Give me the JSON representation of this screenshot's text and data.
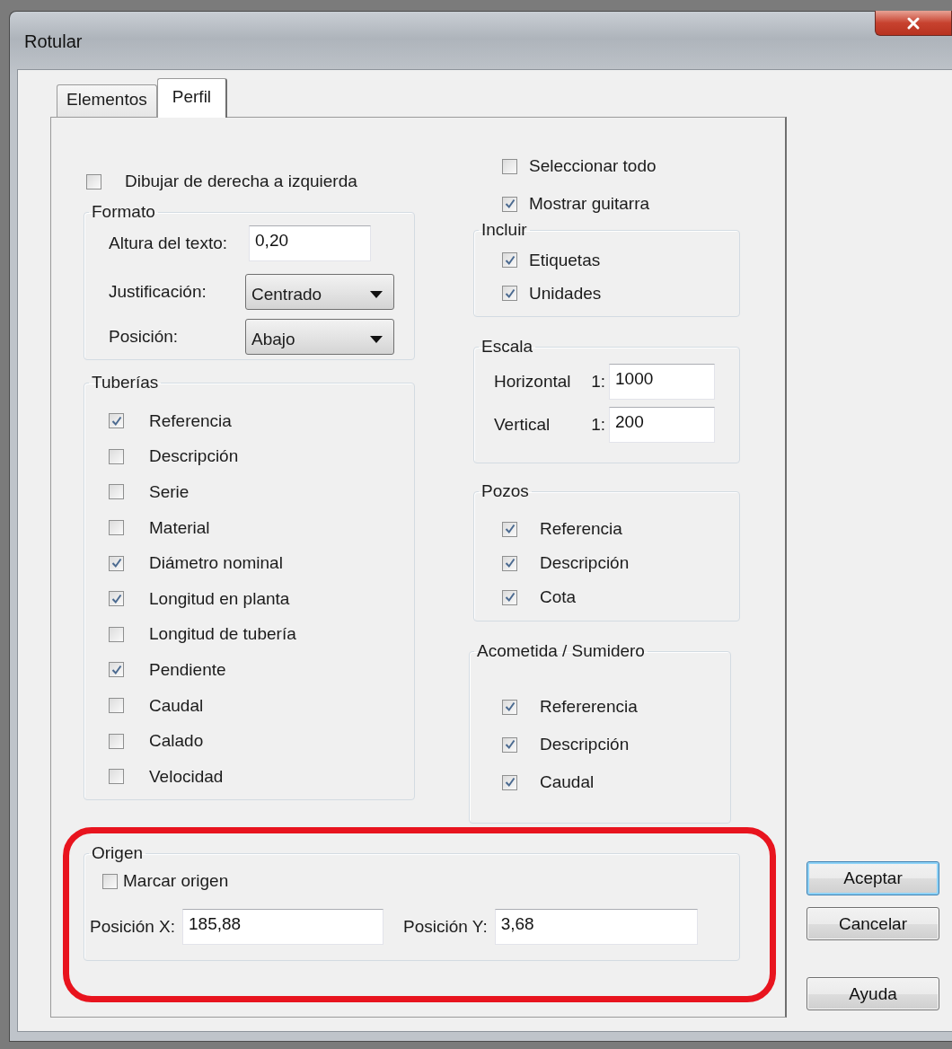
{
  "window": {
    "title": "Rotular"
  },
  "tabs": [
    {
      "label": "Elementos",
      "selected": false
    },
    {
      "label": "Perfil",
      "selected": true
    }
  ],
  "draw_right_to_left": {
    "label": "Dibujar de derecha a izquierda",
    "checked": false
  },
  "select_all": {
    "label": "Seleccionar todo",
    "checked": false
  },
  "show_guitar": {
    "label": "Mostrar guitarra",
    "checked": true
  },
  "formato": {
    "title": "Formato",
    "text_height": {
      "label": "Altura del texto:",
      "value": "0,20"
    },
    "justification": {
      "label": "Justificación:",
      "value": "Centrado"
    },
    "position": {
      "label": "Posición:",
      "value": "Abajo"
    }
  },
  "tuberias": {
    "title": "Tuberías",
    "items": [
      {
        "label": "Referencia",
        "checked": true
      },
      {
        "label": "Descripción",
        "checked": false
      },
      {
        "label": "Serie",
        "checked": false
      },
      {
        "label": "Material",
        "checked": false
      },
      {
        "label": "Diámetro nominal",
        "checked": true
      },
      {
        "label": "Longitud en planta",
        "checked": true
      },
      {
        "label": "Longitud de tubería",
        "checked": false
      },
      {
        "label": "Pendiente",
        "checked": true
      },
      {
        "label": "Caudal",
        "checked": false
      },
      {
        "label": "Calado",
        "checked": false
      },
      {
        "label": "Velocidad",
        "checked": false
      }
    ]
  },
  "incluir": {
    "title": "Incluir",
    "items": [
      {
        "label": "Etiquetas",
        "checked": true
      },
      {
        "label": "Unidades",
        "checked": true
      }
    ]
  },
  "escala": {
    "title": "Escala",
    "fields": [
      {
        "label": "Horizontal",
        "ratio": "1:",
        "value": "1000"
      },
      {
        "label": "Vertical",
        "ratio": "1:",
        "value": "200"
      }
    ]
  },
  "pozos": {
    "title": "Pozos",
    "items": [
      {
        "label": "Referencia",
        "checked": true
      },
      {
        "label": "Descripción",
        "checked": true
      },
      {
        "label": "Cota",
        "checked": true
      }
    ]
  },
  "acometida": {
    "title": "Acometida / Sumidero",
    "items": [
      {
        "label": "Refererencia",
        "checked": true
      },
      {
        "label": "Descripción",
        "checked": true
      },
      {
        "label": "Caudal",
        "checked": true
      }
    ]
  },
  "origen": {
    "title": "Origen",
    "mark": {
      "label": "Marcar origen",
      "checked": false
    },
    "x": {
      "label": "Posición X:",
      "value": "185,88"
    },
    "y": {
      "label": "Posición Y:",
      "value": "3,68"
    }
  },
  "buttons": [
    {
      "label": "Aceptar",
      "default": true
    },
    {
      "label": "Cancelar",
      "default": false
    },
    {
      "label": "Ayuda",
      "default": false
    }
  ]
}
